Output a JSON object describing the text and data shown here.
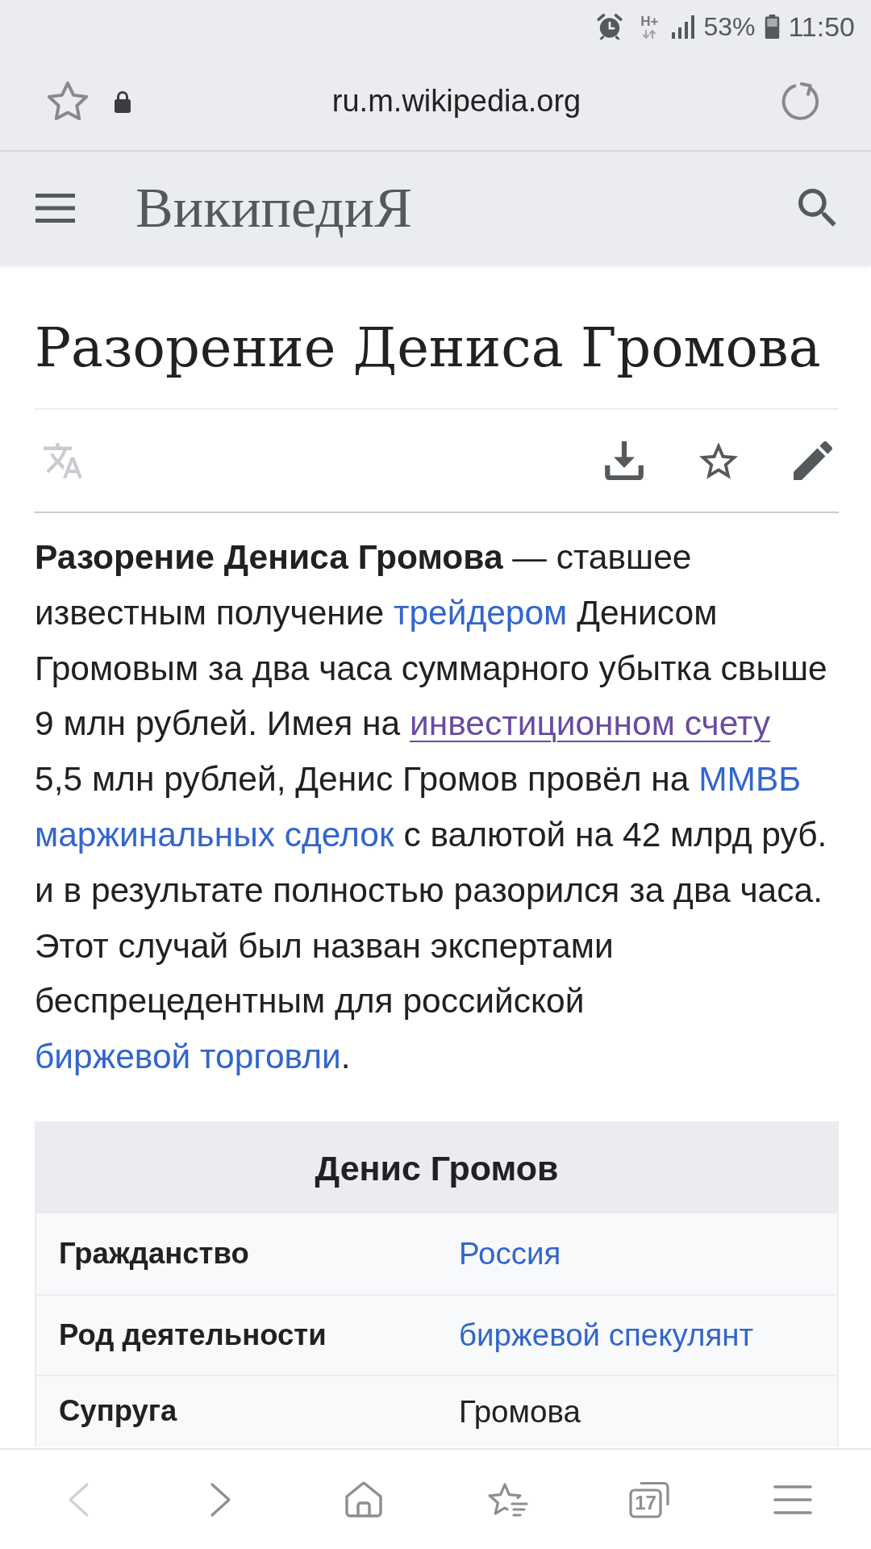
{
  "status_bar": {
    "network": "H+",
    "battery": "53%",
    "time": "11:50"
  },
  "address_bar": {
    "url": "ru.m.wikipedia.org"
  },
  "site_header": {
    "logo": "ВикипедиЯ"
  },
  "article": {
    "title": "Разорение Дениса Громова",
    "actions": [
      {
        "kind": "language",
        "disabled": true
      },
      {
        "kind": "download",
        "disabled": false
      },
      {
        "kind": "watch",
        "disabled": false
      },
      {
        "kind": "edit",
        "disabled": false
      }
    ],
    "intro": [
      {
        "kind": "bold",
        "text": "Разорение Дениса Громова"
      },
      {
        "kind": "text",
        "text": " — ставшее\nизвестным получение "
      },
      {
        "kind": "link",
        "text": "трейдером",
        "visited": false
      },
      {
        "kind": "text",
        "text": " Денисом Громовым за два часа суммарного убытка свыше 9 млн рублей. Имея на "
      },
      {
        "kind": "link",
        "text": "инвестиционном счету",
        "visited": true
      },
      {
        "kind": "text",
        "text": " 5,5 млн рублей, Денис Громов провёл на "
      },
      {
        "kind": "link",
        "text": "ММВБ",
        "visited": false
      },
      {
        "kind": "link",
        "text": "маржинальных сделок",
        "visited": false
      },
      {
        "kind": "text",
        "text": " с валютой на 42 млрд руб. и в результате полностью разорился за два часа. Этот случай был назван экспертами беспрецедентным для российской "
      },
      {
        "kind": "link",
        "text": "биржевой торговли",
        "visited": false
      },
      {
        "kind": "text",
        "text": "."
      }
    ],
    "infobox": {
      "title": "Денис Громов",
      "rows": [
        {
          "label": "Гражданство",
          "value": {
            "kind": "link",
            "text": "Россия"
          }
        },
        {
          "label": "Род деятельности",
          "value": {
            "kind": "link",
            "text": "биржевой спекулянт"
          }
        },
        {
          "label": "Супруга",
          "value": {
            "kind": "text",
            "text": "Громова"
          }
        }
      ]
    }
  },
  "toolbar": {
    "buttons": [
      {
        "kind": "back",
        "disabled": true
      },
      {
        "kind": "forward",
        "disabled": false
      },
      {
        "kind": "home",
        "disabled": false
      },
      {
        "kind": "bookmarks",
        "disabled": false
      },
      {
        "kind": "tabs",
        "disabled": false,
        "count": "17"
      },
      {
        "kind": "menu",
        "disabled": false
      }
    ]
  }
}
